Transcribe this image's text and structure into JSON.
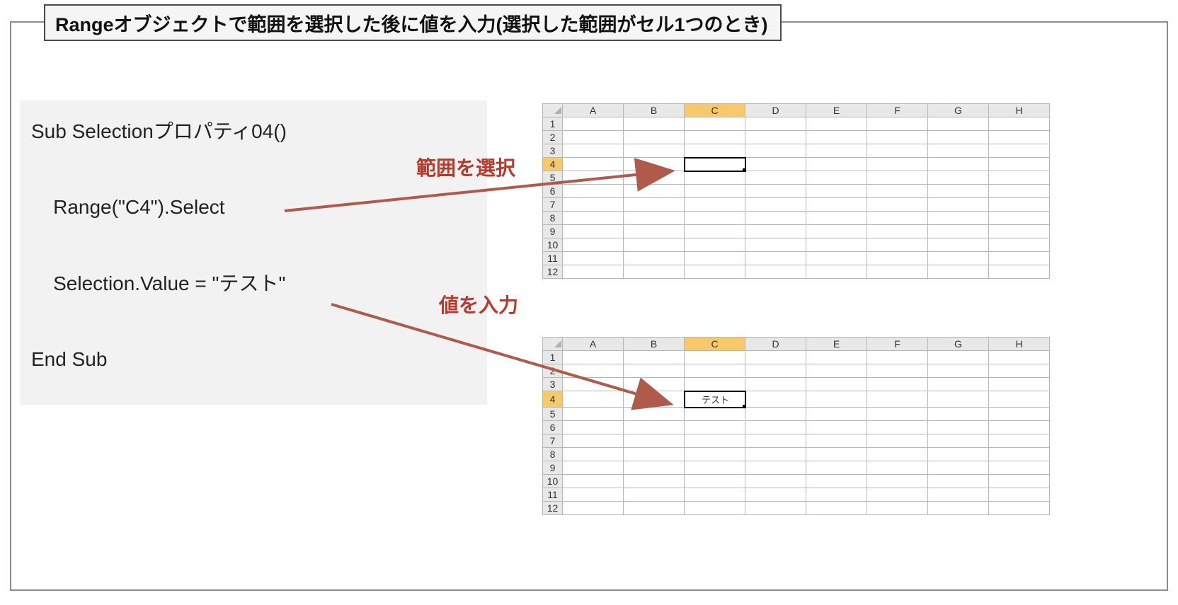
{
  "title": "Rangeオブジェクトで範囲を選択した後に値を入力(選択した範囲がセル1つのとき)",
  "code": {
    "l1": "Sub Selectionプロパティ04()",
    "l2": "    Range(\"C4\").Select",
    "l3": "    Selection.Value = \"テスト\"",
    "l4": "End Sub"
  },
  "annotations": {
    "a1": "範囲を選択",
    "a2": "値を入力"
  },
  "spreadsheet": {
    "columns": [
      "A",
      "B",
      "C",
      "D",
      "E",
      "F",
      "G",
      "H"
    ],
    "rows": [
      "1",
      "2",
      "3",
      "4",
      "5",
      "6",
      "7",
      "8",
      "9",
      "10",
      "11",
      "12"
    ],
    "selected_column": "C",
    "selected_row": "4",
    "sheet1_value": "",
    "sheet2_value": "テスト"
  }
}
